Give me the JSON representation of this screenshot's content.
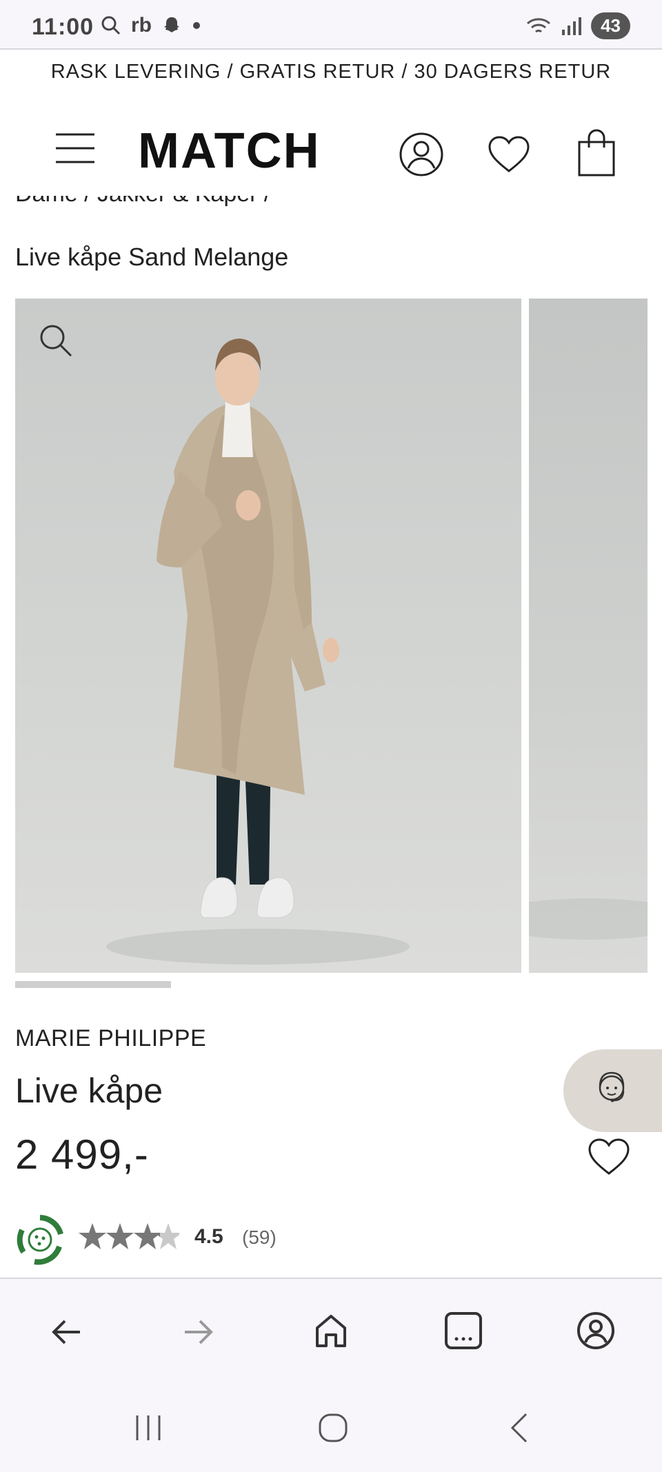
{
  "status_bar": {
    "time": "11:00",
    "carrier_text": "rb",
    "battery": "43"
  },
  "promo": {
    "text": "RASK LEVERING / GRATIS RETUR / 30 DAGERS RETUR"
  },
  "header": {
    "logo": "MATCH"
  },
  "breadcrumb": {
    "trail": "Dame  /  Jakker & Kåper  /",
    "current": "Live kåpe Sand Melange"
  },
  "gallery": {
    "progress_fraction": 0.25
  },
  "product": {
    "brand": "MARIE PHILIPPE",
    "name": "Live kåpe",
    "price": "2 499,-",
    "rating": "4.5",
    "review_count": "(59)",
    "rating_stars": 4.5
  },
  "colors": {
    "accent_green": "#2f7d3a",
    "star_grey": "#777777",
    "chat_fab": "#ddd8d2"
  },
  "icons": {
    "menu": "hamburger-icon",
    "account": "user-circle-icon",
    "wishlist": "heart-icon",
    "cart": "shopping-bag-icon",
    "zoom": "search-icon",
    "chat": "customer-service-icon",
    "sustainability": "eco-badge-icon"
  },
  "browser_nav": [
    "back",
    "forward",
    "home",
    "tabs",
    "account"
  ],
  "system_nav": [
    "recents",
    "home",
    "back"
  ]
}
